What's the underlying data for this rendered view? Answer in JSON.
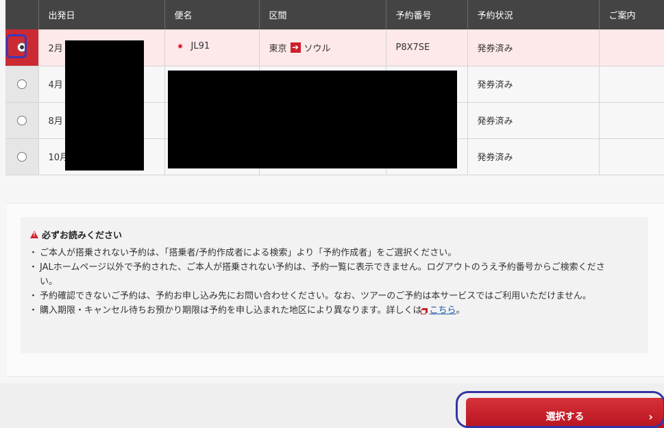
{
  "table": {
    "headers": [
      "出発日",
      "便名",
      "区間",
      "予約番号",
      "予約状況",
      "ご案内"
    ],
    "rows": [
      {
        "date": "2月",
        "flight": "JL91",
        "from": "東京",
        "to": "ソウル",
        "booking_no": "P8X7SE",
        "status": "発券済み",
        "info": "",
        "selected": true
      },
      {
        "date": "4月",
        "flight": "",
        "from": "",
        "to": "",
        "booking_no": "",
        "status": "発券済み",
        "info": "",
        "selected": false
      },
      {
        "date": "8月",
        "flight": "",
        "from": "",
        "to": "",
        "booking_no": "",
        "status": "発券済み",
        "info": "",
        "selected": false
      },
      {
        "date": "10月",
        "flight": "",
        "from": "",
        "to": "",
        "booking_no": "",
        "status": "発券済み",
        "info": "",
        "selected": false
      }
    ]
  },
  "notice": {
    "title": "必ずお読みください",
    "items": [
      "ご本人が搭乗されない予約は、「搭乗者/予約作成者による検索」より「予約作成者」をご選択ください。",
      "JALホームページ以外で予約された、ご本人が搭乗されない予約は、予約一覧に表示できません。ログアウトのうえ予約番号からご検索ください。",
      "予約確認できないご予約は、予約お申し込み先にお問い合わせください。なお、ツアーのご予約は本サービスではご利用いただけません。",
      "購入期限・キャンセル待ちお預かり期限は予約を申し込まれた地区により異なります。詳しくは"
    ],
    "link_text": "こちら",
    "link_suffix": "。"
  },
  "select_button": {
    "label": "選択する",
    "chevron": "›"
  },
  "colors": {
    "header_bg": "#444444",
    "accent_red": "#cc2a33",
    "selected_row": "#fde8ea",
    "link": "#1a55a8"
  },
  "icons": {
    "airline": "jal-crane-icon",
    "route_arrow": "arrow-right-icon",
    "warning": "warning-icon",
    "external_link": "external-link-icon"
  }
}
